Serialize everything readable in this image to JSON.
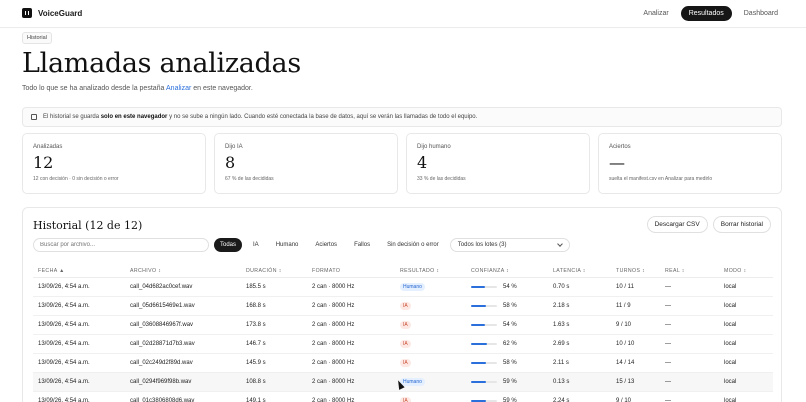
{
  "app": {
    "name": "VoiceGuard"
  },
  "nav": [
    {
      "label": "Analizar",
      "active": false
    },
    {
      "label": "Resultados",
      "active": true
    },
    {
      "label": "Dashboard",
      "active": false
    }
  ],
  "breadcrumb": "Historial",
  "page": {
    "title": "Llamadas analizadas",
    "subtitle_pre": "Todo lo que se ha analizado desde la pestaña ",
    "subtitle_link": "Analizar",
    "subtitle_post": " en este navegador."
  },
  "notice": {
    "pre": "El historial se guarda ",
    "bold": "solo en este navegador",
    "post": " y no se sube a ningún lado. Cuando esté conectada la base de datos, aquí se verán las llamadas de todo el equipo."
  },
  "stats": [
    {
      "label": "Analizadas",
      "value": "12",
      "note": "12 con decisión · 0 sin decisión o error"
    },
    {
      "label": "Dijo IA",
      "value": "8",
      "note": "67 % de las decididas"
    },
    {
      "label": "Dijo humano",
      "value": "4",
      "note": "33 % de las decididas"
    },
    {
      "label": "Aciertos",
      "value": "—",
      "note": "suelta el manifest.csv en Analizar para medirlo"
    }
  ],
  "history": {
    "title": "Historial (12 de 12)",
    "download_label": "Descargar CSV",
    "clear_label": "Borrar historial",
    "search_placeholder": "Buscar por archivo...",
    "filters": [
      {
        "label": "Todas",
        "active": true
      },
      {
        "label": "IA",
        "active": false
      },
      {
        "label": "Humano",
        "active": false
      },
      {
        "label": "Aciertos",
        "active": false
      },
      {
        "label": "Fallos",
        "active": false
      },
      {
        "label": "Sin decisión o error",
        "active": false
      }
    ],
    "batch_select": "Todos los lotes (3)"
  },
  "table": {
    "headers": [
      "FECHA ▲",
      "ARCHIVO ↕",
      "DURACIÓN ↕",
      "FORMATO",
      "RESULTADO ↕",
      "CONFIANZA ↕",
      "LATENCIA ↕",
      "TURNOS ↕",
      "REAL ↕",
      "MODO ↕"
    ],
    "rows": [
      {
        "fecha": "13/09/26, 4:54 a.m.",
        "archivo": "call_04d682ac0cef.wav",
        "duracion": "185.5 s",
        "formato": "2 can · 8000 Hz",
        "resultado": "Humano",
        "tipo": "human",
        "confianza": "54 %",
        "conf_pct": 54,
        "latencia": "0.70 s",
        "turnos": "10 / 11",
        "real": "—",
        "modo": "local"
      },
      {
        "fecha": "13/09/26, 4:54 a.m.",
        "archivo": "call_05d6615469e1.wav",
        "duracion": "168.8 s",
        "formato": "2 can · 8000 Hz",
        "resultado": "IA",
        "tipo": "ai",
        "confianza": "58 %",
        "conf_pct": 58,
        "latencia": "2.18 s",
        "turnos": "11 / 9",
        "real": "—",
        "modo": "local"
      },
      {
        "fecha": "13/09/26, 4:54 a.m.",
        "archivo": "call_03608846967f.wav",
        "duracion": "173.8 s",
        "formato": "2 can · 8000 Hz",
        "resultado": "IA",
        "tipo": "ai",
        "confianza": "54 %",
        "conf_pct": 54,
        "latencia": "1.63 s",
        "turnos": "9 / 10",
        "real": "—",
        "modo": "local"
      },
      {
        "fecha": "13/09/26, 4:54 a.m.",
        "archivo": "call_02d28871d7b3.wav",
        "duracion": "146.7 s",
        "formato": "2 can · 8000 Hz",
        "resultado": "IA",
        "tipo": "ai",
        "confianza": "62 %",
        "conf_pct": 62,
        "latencia": "2.69 s",
        "turnos": "10 / 10",
        "real": "—",
        "modo": "local"
      },
      {
        "fecha": "13/09/26, 4:54 a.m.",
        "archivo": "call_02c249d2f89d.wav",
        "duracion": "145.9 s",
        "formato": "2 can · 8000 Hz",
        "resultado": "IA",
        "tipo": "ai",
        "confianza": "58 %",
        "conf_pct": 58,
        "latencia": "2.11 s",
        "turnos": "14 / 14",
        "real": "—",
        "modo": "local"
      },
      {
        "fecha": "13/09/26, 4:54 a.m.",
        "archivo": "call_0294f969f98b.wav",
        "duracion": "108.8 s",
        "formato": "2 can · 8000 Hz",
        "resultado": "Humano",
        "tipo": "human",
        "confianza": "59 %",
        "conf_pct": 59,
        "latencia": "0.13 s",
        "turnos": "15 / 13",
        "real": "—",
        "modo": "local"
      },
      {
        "fecha": "13/09/26, 4:54 a.m.",
        "archivo": "call_01c3806808d6.wav",
        "duracion": "149.1 s",
        "formato": "2 can · 8000 Hz",
        "resultado": "IA",
        "tipo": "ai",
        "confianza": "59 %",
        "conf_pct": 59,
        "latencia": "2.24 s",
        "turnos": "9 / 10",
        "real": "—",
        "modo": "local"
      }
    ]
  }
}
